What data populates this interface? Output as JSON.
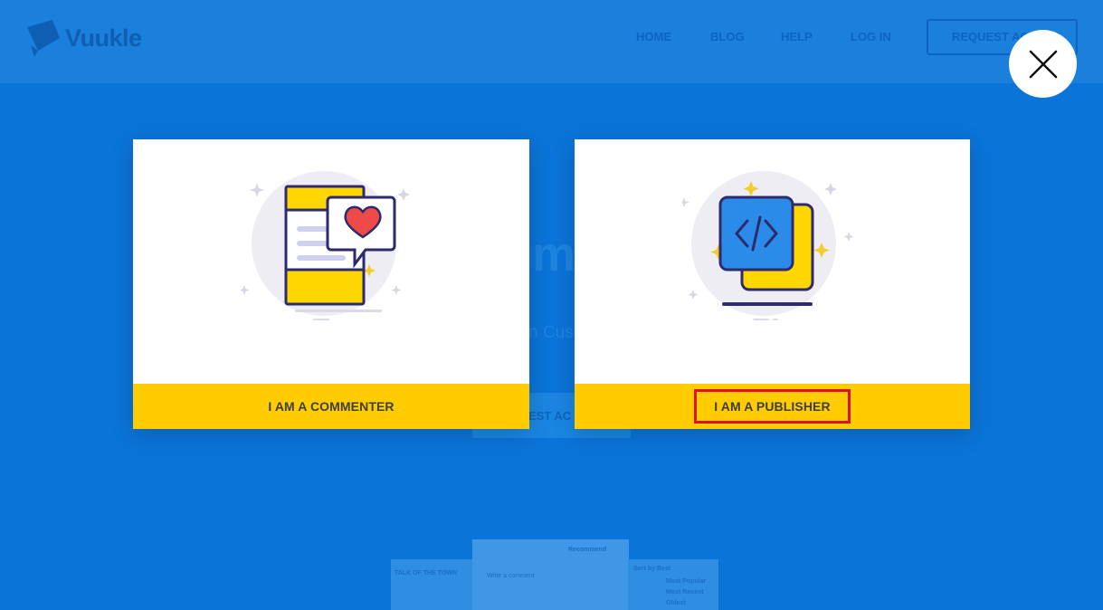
{
  "header": {
    "logo_text": "Vuukle",
    "nav": [
      "HOME",
      "BLOG",
      "HELP",
      "LOG IN"
    ],
    "request_button": "REQUEST ACCESS"
  },
  "background": {
    "hero_fragment": "mm",
    "subtitle_fragment": "n Cus",
    "button_fragment": "EST AC",
    "preview": {
      "section_title": "TALK OF THE TOWN",
      "recommend": "Recommend",
      "comment_placeholder": "Write a comment",
      "sort_label": "Sort by:",
      "sort_value": "Best",
      "sort_options": [
        "Most Popular",
        "Most Recent",
        "Oldest"
      ]
    }
  },
  "modal": {
    "commenter_label": "I AM A COMMENTER",
    "publisher_label": "I AM A PUBLISHER",
    "close_icon": "close-icon"
  },
  "colors": {
    "page_bg": "#0b74d8",
    "header_bg": "#1b7fdc",
    "card_footer": "#ffcc00",
    "highlight_border": "#e0102a"
  }
}
